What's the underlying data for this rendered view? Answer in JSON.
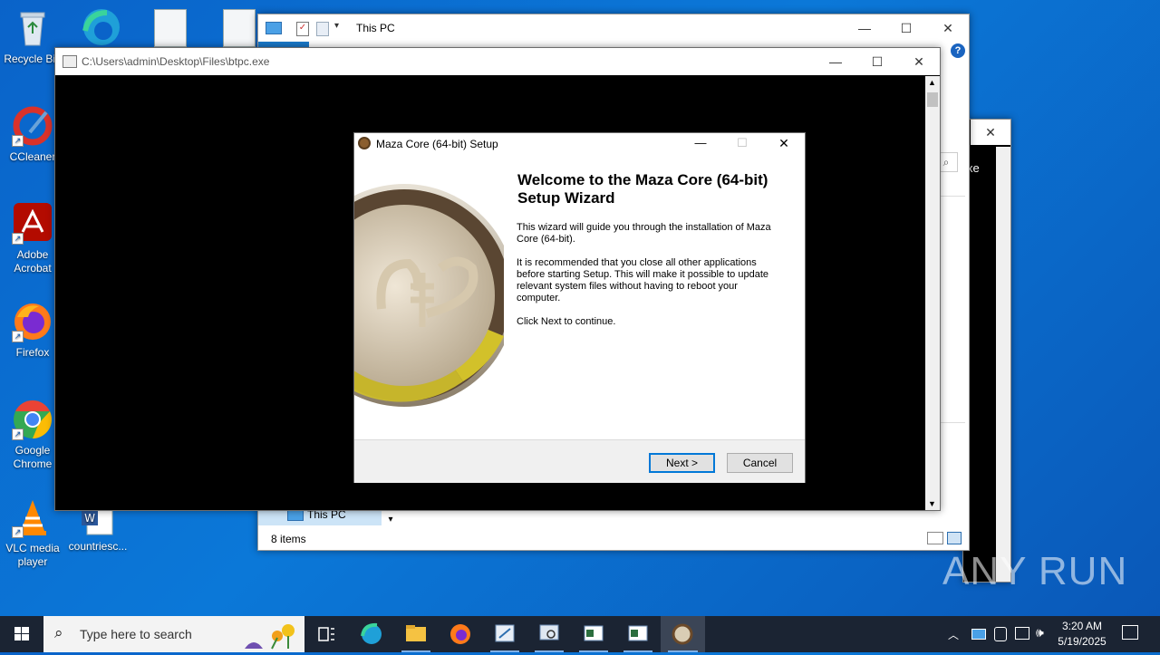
{
  "desktop": {
    "icons": [
      {
        "label": "Recycle Bin"
      },
      {
        "label": "CCleaner"
      },
      {
        "label": "Adobe Acrobat"
      },
      {
        "label": "Firefox"
      },
      {
        "label": "Google Chrome"
      },
      {
        "label": "VLC media player"
      },
      {
        "label": "countriesc..."
      }
    ]
  },
  "explorer": {
    "title": "This PC",
    "nav_item": "This PC",
    "status": "8 items",
    "partial_text": "xe"
  },
  "console": {
    "title": "C:\\Users\\admin\\Desktop\\Files\\btpc.exe"
  },
  "setup": {
    "title": "Maza Core (64-bit) Setup",
    "heading": "Welcome to the Maza Core (64-bit) Setup Wizard",
    "para1": "This wizard will guide you through the installation of Maza Core (64-bit).",
    "para2": "It is recommended that you close all other applications before starting Setup. This will make it possible to update relevant system files without having to reboot your computer.",
    "para3": "Click Next to continue.",
    "next_label": "Next >",
    "cancel_label": "Cancel"
  },
  "taskbar": {
    "search_placeholder": "Type here to search",
    "time": "3:20 AM",
    "date": "5/19/2025"
  },
  "watermark": "ANY RUN",
  "colors": {
    "accent": "#0078d7",
    "desktop": "#0b78d8",
    "taskbar": "#1b2433"
  }
}
